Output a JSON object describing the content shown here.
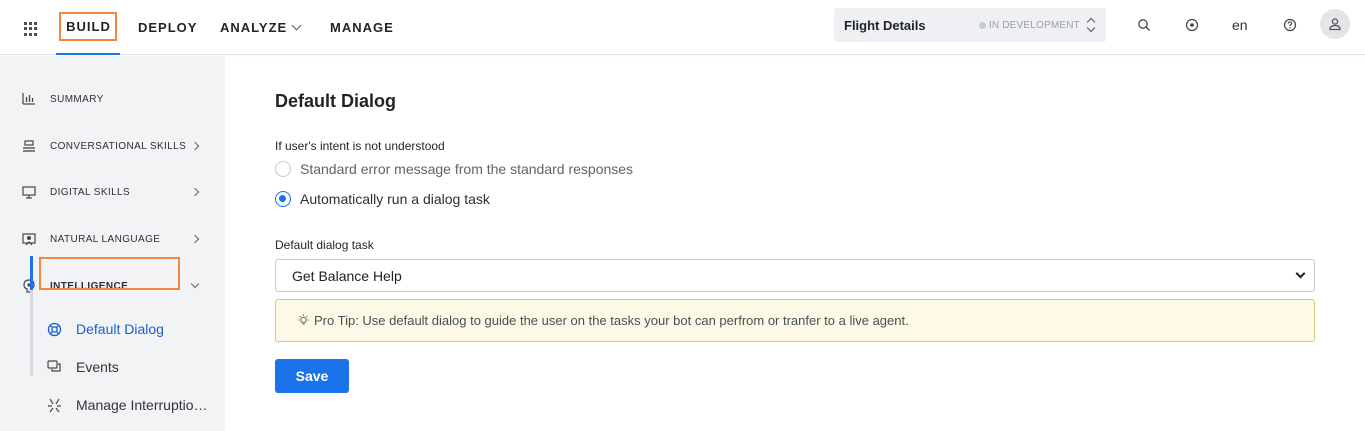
{
  "header": {
    "nav": {
      "build": "BUILD",
      "deploy": "DEPLOY",
      "analyze": "ANALYZE",
      "manage": "MANAGE"
    },
    "bot": {
      "name": "Flight Details",
      "status": "IN DEVELOPMENT"
    },
    "language": "en",
    "icons": [
      "apps-grid-icon",
      "search-icon",
      "notification-icon",
      "help-icon",
      "user-icon"
    ]
  },
  "sidebar": {
    "items": [
      {
        "label": "SUMMARY",
        "icon": "bar-chart-icon"
      },
      {
        "label": "CONVERSATIONAL SKILLS",
        "icon": "conversation-icon"
      },
      {
        "label": "DIGITAL SKILLS",
        "icon": "monitor-icon"
      },
      {
        "label": "NATURAL LANGUAGE",
        "icon": "nlp-icon"
      },
      {
        "label": "INTELLIGENCE",
        "icon": "intelligence-icon"
      }
    ],
    "sub_items": [
      {
        "label": "Default Dialog",
        "icon": "lifebuoy-icon",
        "active": true
      },
      {
        "label": "Events",
        "icon": "chat-bubbles-icon",
        "active": false
      },
      {
        "label": "Manage Interruptions",
        "icon": "interruption-icon",
        "active": false
      }
    ]
  },
  "main": {
    "title": "Default Dialog",
    "intent_label": "If user's intent is not understood",
    "options": [
      {
        "label": "Standard error message from the standard responses",
        "checked": false
      },
      {
        "label": "Automatically run a dialog task",
        "checked": true
      }
    ],
    "task_label": "Default dialog task",
    "task_value": "Get Balance Help",
    "pro_tip": "Pro Tip: Use default dialog to guide the user on the tasks your bot can perfrom or tranfer to a live agent.",
    "save_label": "Save"
  },
  "colors": {
    "accent": "#1a73e8",
    "highlight": "#f0883e",
    "tip_background": "#fdf9e6"
  }
}
